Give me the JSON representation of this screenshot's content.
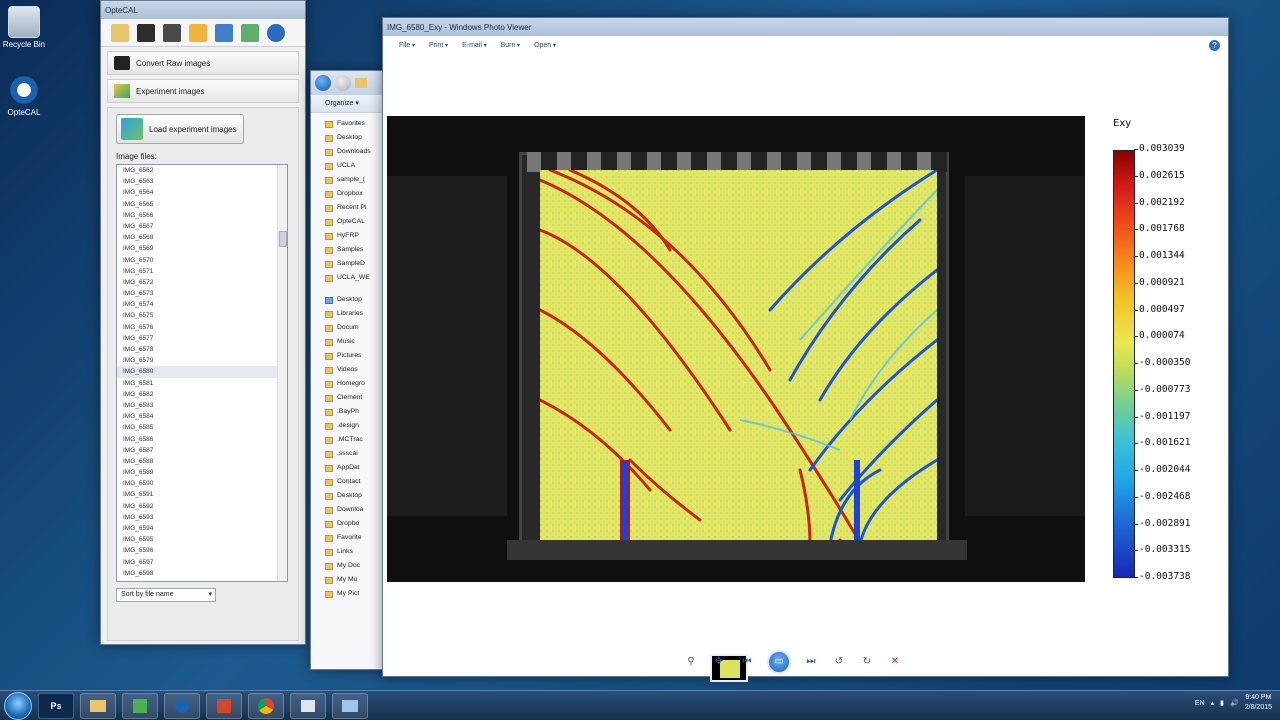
{
  "desktop": {
    "icons": [
      {
        "label": "Recycle Bin",
        "icon": "recycle-bin-icon"
      },
      {
        "label": "OpteCAL",
        "icon": "optecal-icon"
      }
    ]
  },
  "optecal": {
    "title": "OpteCAL",
    "sections": {
      "convert_raw": "Convert Raw images",
      "experiment_images": "Experiment images"
    },
    "load_button": "Load experiment images",
    "files_label": "Image files:",
    "files": [
      "IMG_6562",
      "IMG_6563",
      "IMG_6564",
      "IMG_6565",
      "IMG_6566",
      "IMG_6567",
      "IMG_6568",
      "IMG_6569",
      "IMG_6570",
      "IMG_6571",
      "IMG_6572",
      "IMG_6573",
      "IMG_6574",
      "IMG_6575",
      "IMG_6576",
      "IMG_6577",
      "IMG_6578",
      "IMG_6579",
      "IMG_6580",
      "IMG_6581",
      "IMG_6582",
      "IMG_6583",
      "IMG_6584",
      "IMG_6585",
      "IMG_6586",
      "IMG_6587",
      "IMG_6588",
      "IMG_6589",
      "IMG_6590",
      "IMG_6591",
      "IMG_6592",
      "IMG_6593",
      "IMG_6594",
      "IMG_6595",
      "IMG_6596",
      "IMG_6597",
      "IMG_6598"
    ],
    "selected_file": "IMG_6580",
    "sort_option": "Sort by file name"
  },
  "explorer": {
    "organize": "Organize ▾",
    "favorites": "Favorites",
    "tree": [
      "Desktop",
      "Downloads",
      "UCLA",
      "sample_(",
      "Dropbox",
      "Recent Pl",
      "OpteCAL",
      "HyFRP",
      "Samples",
      "SampleD",
      "UCLA_WE"
    ],
    "desktop_group": "Desktop",
    "tree2": [
      "Libraries",
      "Docum",
      "Music",
      "Pictures",
      "Videos",
      "Homegro",
      "Clement",
      ".BayPh",
      ".design",
      ".MCTrac",
      ".ssscai",
      "AppDat",
      "Contact",
      "Desktop",
      "Downloa",
      "Dropbo",
      "Favorite",
      "Links",
      "My Doc",
      "My Mu",
      "My Pict"
    ]
  },
  "viewer": {
    "title": "IMG_6580_Exy - Windows Photo Viewer",
    "menu": [
      "File",
      "Print",
      "E-mail",
      "Burn",
      "Open"
    ],
    "help": "?",
    "colorbar": {
      "label": "Exy",
      "ticks": [
        "0.003039",
        "0.002615",
        "0.002192",
        "0.001768",
        "0.001344",
        "0.000921",
        "0.000497",
        "0.000074",
        "-0.000350",
        "-0.000773",
        "-0.001197",
        "-0.001621",
        "-0.002044",
        "-0.002468",
        "-0.002891",
        "-0.003315",
        "-0.003738"
      ]
    },
    "controls": [
      "zoom-icon",
      "actual-size-icon",
      "previous-icon",
      "slideshow-icon",
      "next-icon",
      "rotate-ccw-icon",
      "rotate-cw-icon",
      "delete-icon"
    ]
  },
  "taskbar": {
    "apps": [
      "Ps",
      "",
      "",
      "",
      "",
      "",
      "",
      ""
    ],
    "tray_lang": "EN",
    "time": "9:40 PM",
    "date": "2/8/2015"
  }
}
